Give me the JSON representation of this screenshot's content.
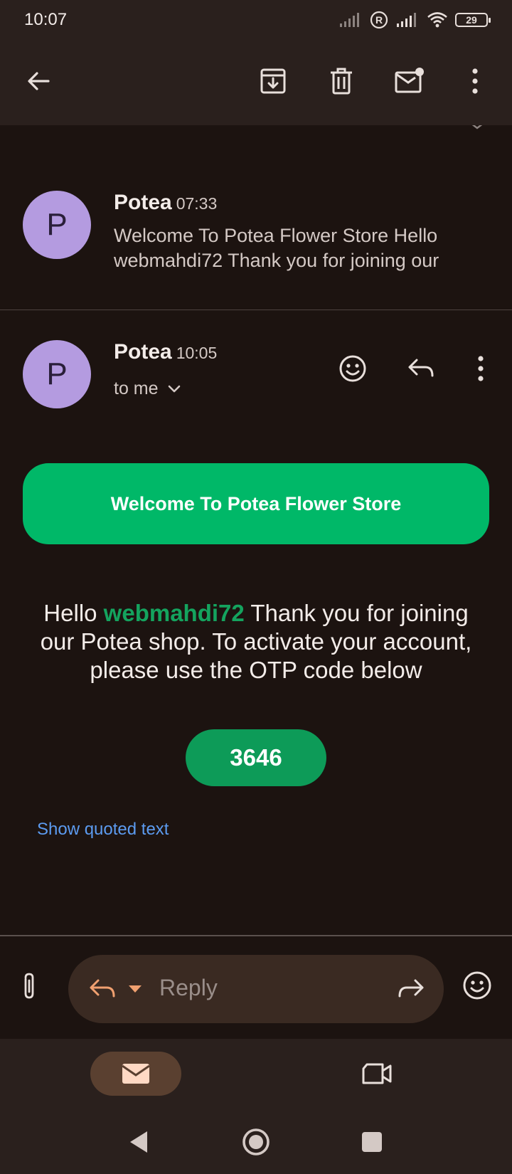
{
  "status_bar": {
    "time": "10:07",
    "battery": "29",
    "roaming_indicator": "R"
  },
  "app_bar": {
    "icons": [
      "back-arrow-icon",
      "archive-icon",
      "delete-icon",
      "mark-unread-icon",
      "more-vert-icon"
    ]
  },
  "thread": {
    "collapsed_message": {
      "avatar_letter": "P",
      "sender": "Potea",
      "time": "07:33",
      "snippet": "Welcome To Potea Flower Store Hello webmahdi72 Thank you for joining our"
    },
    "open_message": {
      "avatar_letter": "P",
      "sender": "Potea",
      "time": "10:05",
      "recipient": "to me",
      "banner": "Welcome To Potea Flower Store",
      "body_hello": "Hello",
      "body_user": "webmahdi72",
      "body_rest": "Thank you for joining our Potea shop. To activate your account, please use the OTP code below",
      "otp_code": "3646",
      "show_quoted": "Show quoted text"
    }
  },
  "composer": {
    "placeholder": "Reply"
  },
  "colors": {
    "accent_green": "#00b868",
    "otp_green": "#0d9b58",
    "link_blue": "#5c9bf0",
    "avatar_purple": "#b49be0"
  }
}
